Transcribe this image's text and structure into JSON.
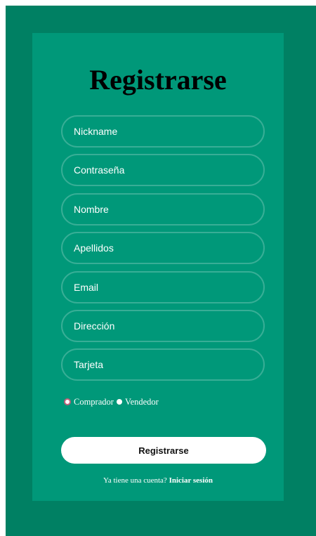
{
  "form": {
    "title": "Registrarse",
    "fields": {
      "nickname": {
        "placeholder": "Nickname",
        "value": ""
      },
      "password": {
        "placeholder": "Contraseña",
        "value": ""
      },
      "first_name": {
        "placeholder": "Nombre",
        "value": ""
      },
      "last_name": {
        "placeholder": "Apellidos",
        "value": ""
      },
      "email": {
        "placeholder": "Email",
        "value": ""
      },
      "address": {
        "placeholder": "Dirección",
        "value": ""
      },
      "card": {
        "placeholder": "Tarjeta",
        "value": ""
      }
    },
    "roles": {
      "buyer_label": "Comprador",
      "seller_label": "Vendedor",
      "selected": "Comprador"
    },
    "submit_label": "Registrarse",
    "footer": {
      "prompt": "Ya tiene una cuenta?",
      "link_label": "Iniciar sesión"
    }
  },
  "colors": {
    "outer_background": "#008063",
    "card_background": "#009879",
    "button_background": "#ffffff",
    "radio_selected_border": "#c1607a"
  }
}
